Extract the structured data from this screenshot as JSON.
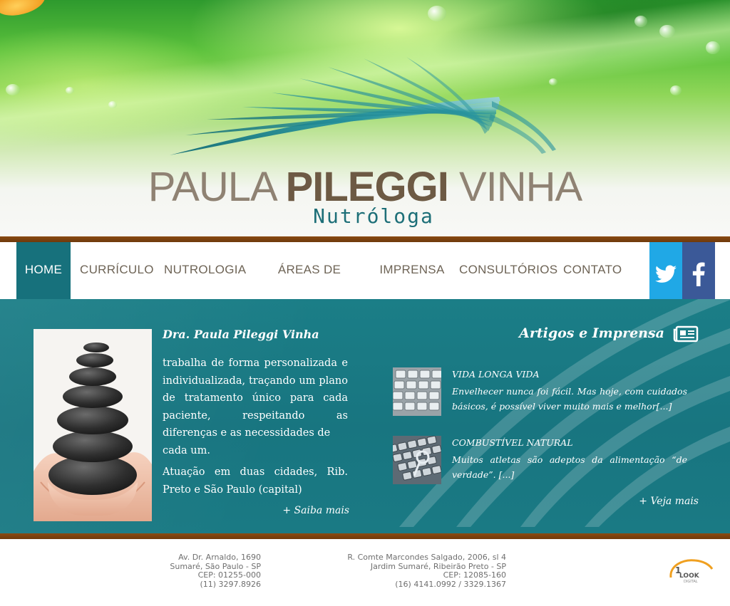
{
  "header": {
    "name_regular_1": "PAULA",
    "name_bold": "PILEGGI",
    "name_regular_2": "VINHA",
    "subtitle": "Nutróloga"
  },
  "nav": {
    "items": [
      {
        "label": "HOME",
        "active": true
      },
      {
        "label": "CURRÍCULO"
      },
      {
        "label": "NUTROLOGIA"
      },
      {
        "label": "ÁREAS DE ATUAÇÃO"
      },
      {
        "label": "IMPRENSA"
      },
      {
        "label": "CONSULTÓRIOS"
      },
      {
        "label": "CONTATO"
      }
    ],
    "social": [
      {
        "icon": "twitter-icon",
        "color": "#20a8e6"
      },
      {
        "icon": "facebook-icon",
        "color": "#3b5998"
      }
    ]
  },
  "intro": {
    "title": "Dra. Paula Pileggi Vinha",
    "text_1a": "trabalha de forma personalizada e individualizada, traçando um plano de tratamento único para cada paciente, respeitando as diferenças e as necessidades de",
    "text_1b": "cada um.",
    "text_2": "Atuação em duas cidades, Rib. Preto e São Paulo (capital)",
    "more_link": "+ Saiba mais"
  },
  "articles": {
    "title": "Artigos e Imprensa",
    "items": [
      {
        "title": "VIDA LONGA VIDA",
        "desc": "Envelhecer nunca foi fácil. Mas hoje, com cuidados básicos, é possível viver muito mais e melhor[...]"
      },
      {
        "title": "COMBUSTÍVEL NATURAL",
        "desc": "Muitos atletas são adeptos da alimentação “de verdade”. [...]"
      }
    ],
    "more_link": "+ Veja mais"
  },
  "footer": {
    "address_1": [
      "Av. Dr. Arnaldo, 1690",
      "Sumaré, São Paulo - SP",
      "CEP: 01255-000",
      "(11) 3297.8926"
    ],
    "address_2": [
      "R. Comte Marcondes Salgado, 2006, sl 4",
      "Jardim Sumaré, Ribeirão Preto - SP",
      "CEP: 12085-160",
      "(16) 4141.0992 / 3329.1367"
    ],
    "brand_1": "1",
    "brand_2": "LOOK",
    "brand_3": "DIGITAL"
  },
  "colors": {
    "teal": "#17717c",
    "brown_bar": "#7a400f",
    "nav_text": "#6e6456"
  }
}
